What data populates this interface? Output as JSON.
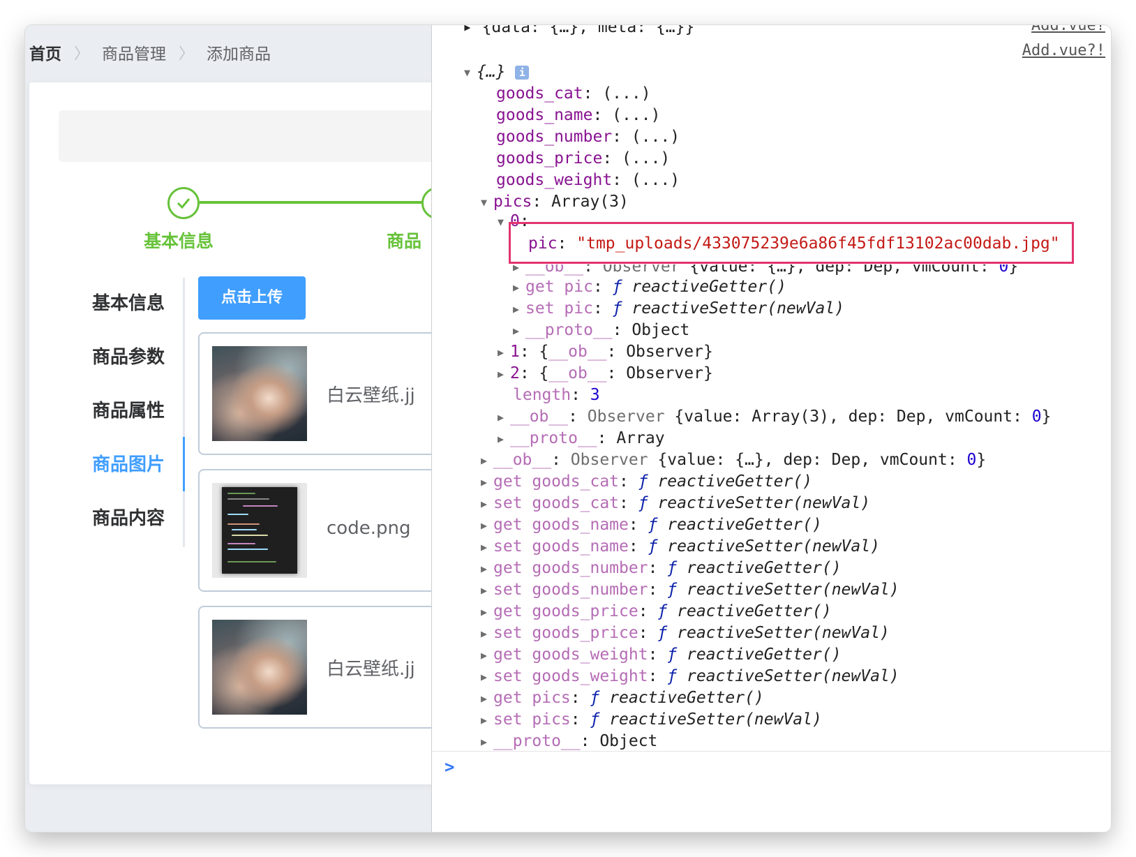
{
  "breadcrumb": [
    "首页",
    "商品管理",
    "添加商品"
  ],
  "steps": [
    "基本信息",
    "商品"
  ],
  "tabs": [
    "基本信息",
    "商品参数",
    "商品属性",
    "商品图片",
    "商品内容"
  ],
  "active_tab": "商品图片",
  "upload_button": "点击上传",
  "files": [
    "白云壁纸.jj",
    "code.png",
    "白云壁纸.jj"
  ],
  "colors": {
    "primary": "#409eff",
    "success": "#67c23a",
    "highlight": "#e3346e"
  },
  "console": {
    "top_line": "▸ {data: {…}, meta: {…}}",
    "top_link": "Add.vue?",
    "source_link": "Add.vue?!",
    "root": "{…}",
    "pic_value": "\"tmp_uploads/433075239e6a86f45fdf13102ac00dab.jpg\""
  }
}
